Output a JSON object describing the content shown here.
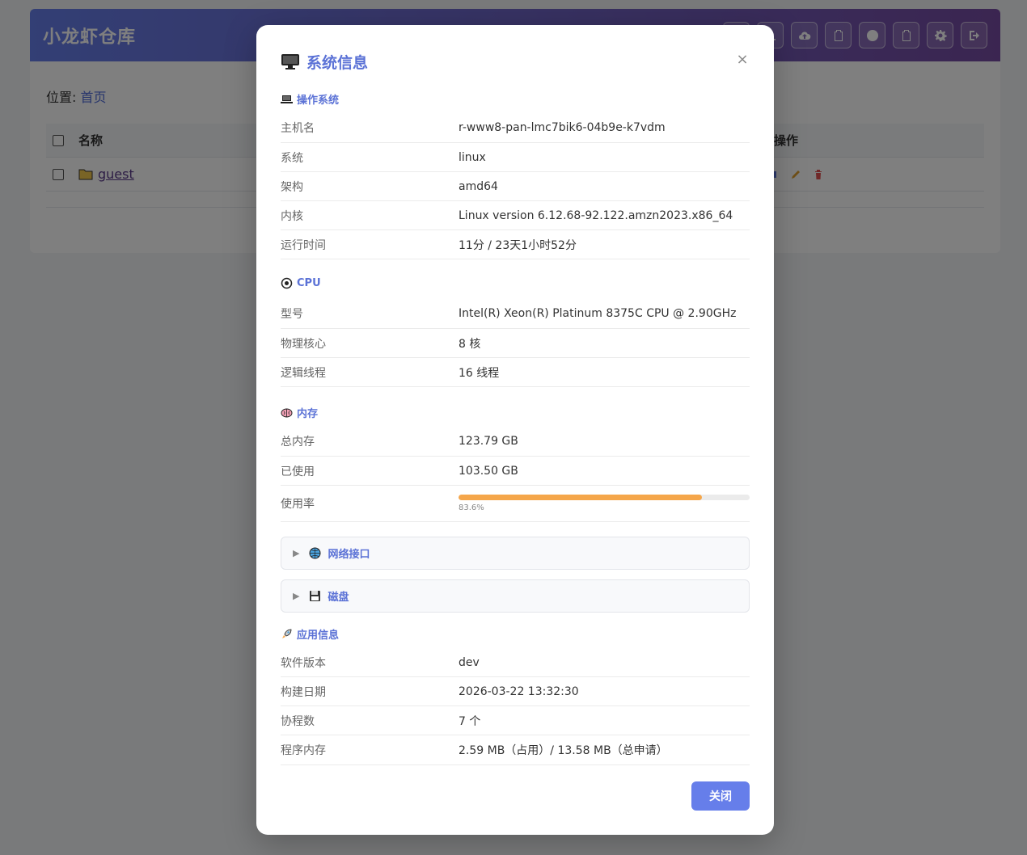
{
  "app": {
    "title": "小龙虾仓库",
    "toolbar_icons": [
      "folder-add-icon",
      "upload-icon",
      "cloud-upload-icon",
      "clipboard-icon",
      "record-icon",
      "clipboard-list-icon",
      "settings-icon",
      "logout-icon"
    ]
  },
  "breadcrumb": {
    "label": "位置:",
    "home": "首页"
  },
  "table": {
    "headers": {
      "name": "名称",
      "ops": "操作"
    },
    "rows": [
      {
        "name": "guest"
      }
    ]
  },
  "modal": {
    "title": "系统信息",
    "close_symbol": "×",
    "os": {
      "heading": "操作系统",
      "rows": [
        {
          "k": "主机名",
          "v": "r-www8-pan-lmc7bik6-04b9e-k7vdm"
        },
        {
          "k": "系统",
          "v": "linux"
        },
        {
          "k": "架构",
          "v": "amd64"
        },
        {
          "k": "内核",
          "v": "Linux version 6.12.68-92.122.amzn2023.x86_64"
        },
        {
          "k": "运行时间",
          "v": "11分 / 23天1小时52分"
        }
      ]
    },
    "cpu": {
      "heading": "CPU",
      "rows": [
        {
          "k": "型号",
          "v": "Intel(R) Xeon(R) Platinum 8375C CPU @ 2.90GHz"
        },
        {
          "k": "物理核心",
          "v": "8 核"
        },
        {
          "k": "逻辑线程",
          "v": "16 线程"
        }
      ]
    },
    "memory": {
      "heading": "内存",
      "rows": [
        {
          "k": "总内存",
          "v": "123.79 GB"
        },
        {
          "k": "已使用",
          "v": "103.50 GB"
        }
      ],
      "usage": {
        "k": "使用率",
        "percent": 83.6,
        "label": "83.6%"
      }
    },
    "network": {
      "label": "网络接口"
    },
    "disk": {
      "label": "磁盘"
    },
    "app": {
      "heading": "应用信息",
      "rows": [
        {
          "k": "软件版本",
          "v": "dev"
        },
        {
          "k": "构建日期",
          "v": "2026-03-22 13:32:30"
        },
        {
          "k": "协程数",
          "v": "7 个"
        },
        {
          "k": "程序内存",
          "v": "2.59 MB（占用）/ 13.58 MB（总申请）"
        }
      ]
    },
    "close_button": "关闭"
  },
  "colors": {
    "accent": "#5b72d6",
    "header_start": "#667eea",
    "header_end": "#764ba2",
    "usage_bar": "#f5a64a"
  }
}
